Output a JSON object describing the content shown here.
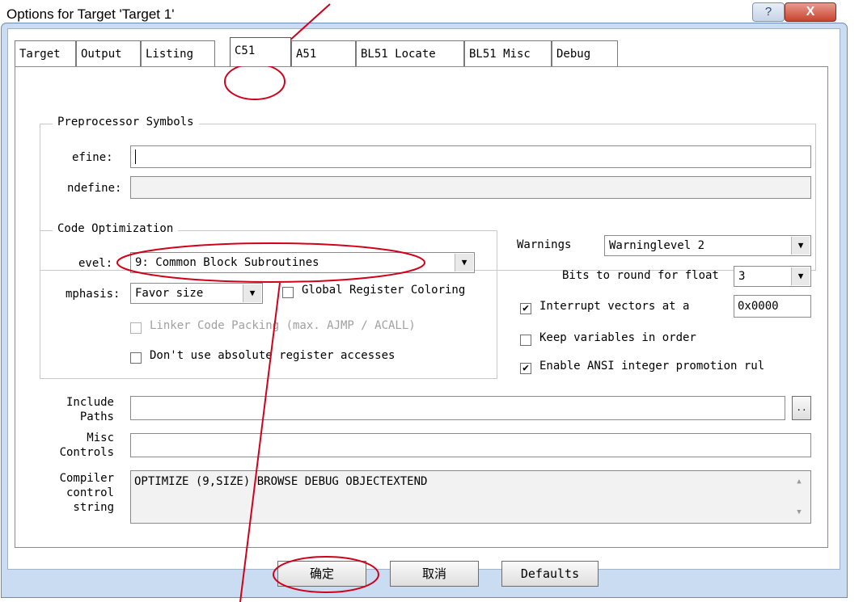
{
  "window": {
    "title": "Options for Target 'Target 1'",
    "help_label": "?",
    "close_label": "X"
  },
  "tabs": [
    {
      "label": "Target"
    },
    {
      "label": "Output"
    },
    {
      "label": "Listing"
    },
    {
      "label": "C51",
      "selected": true
    },
    {
      "label": "A51"
    },
    {
      "label": "BL51 Locate"
    },
    {
      "label": "BL51 Misc"
    },
    {
      "label": "Debug"
    }
  ],
  "preprocessor": {
    "group_label": "Preprocessor Symbols",
    "define_label": "efine:",
    "define_value": "",
    "undefine_label": "ndefine:",
    "undefine_value": ""
  },
  "code_optimization": {
    "group_label": "Code Optimization",
    "level_label": "evel:",
    "level_value": "9: Common Block Subroutines",
    "emphasis_label": "mphasis:",
    "emphasis_value": "Favor size",
    "global_register_coloring": {
      "label": "Global Register Coloring",
      "checked": false
    },
    "linker_code_packing": {
      "label": "Linker Code Packing (max. AJMP / ACALL)",
      "checked": false,
      "disabled": true
    },
    "dont_use_absolute": {
      "label": "Don't use absolute register accesses",
      "checked": false
    }
  },
  "warnings": {
    "label": "Warnings",
    "value": "Warninglevel 2"
  },
  "bits_round": {
    "label": "Bits to round for float",
    "value": "3"
  },
  "interrupt_vectors": {
    "label": "Interrupt vectors at a",
    "checked": true,
    "value": "0x0000"
  },
  "keep_variables": {
    "label": "Keep variables in order",
    "checked": false
  },
  "enable_ansi": {
    "label": "Enable ANSI integer promotion rul",
    "checked": true
  },
  "include_paths": {
    "label_line1": "Include",
    "label_line2": "Paths",
    "value": "",
    "browse_label": ".."
  },
  "misc_controls": {
    "label_line1": "Misc",
    "label_line2": "Controls",
    "value": ""
  },
  "compiler_control": {
    "label_line1": "Compiler",
    "label_line2": "control",
    "label_line3": "string",
    "value": "OPTIMIZE (9,SIZE) BROWSE DEBUG OBJECTEXTEND",
    "scroll_up": "▲",
    "scroll_down": "▼"
  },
  "buttons": {
    "ok": "确定",
    "cancel": "取消",
    "defaults": "Defaults"
  },
  "check_mark": "✔",
  "dropdown_arrow": "▼",
  "annotation_color": "#d0021b"
}
